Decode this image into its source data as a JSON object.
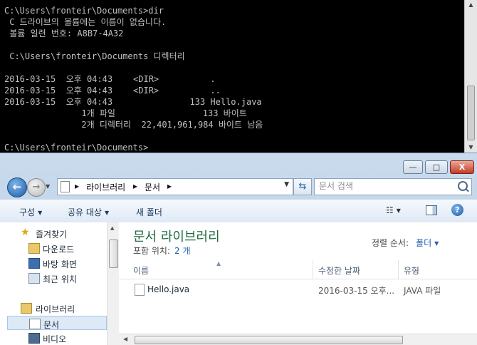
{
  "console": {
    "lines": [
      "C:\\Users\\fronteir\\Documents>dir",
      " C 드라이브의 볼륨에는 이름이 없습니다.",
      " 볼륨 일련 번호: A8B7-4A32",
      "",
      " C:\\Users\\fronteir\\Documents 디렉터리",
      "",
      "2016-03-15  오후 04:43    <DIR>          .",
      "2016-03-15  오후 04:43    <DIR>          ..",
      "2016-03-15  오후 04:43               133 Hello.java",
      "               1개 파일                 133 바이트",
      "               2개 디렉터리  22,401,961,984 바이트 남음",
      "",
      "C:\\Users\\fronteir\\Documents>"
    ]
  },
  "explorer": {
    "window_buttons": {
      "minimize": "—",
      "maximize": "□",
      "close": "X"
    },
    "breadcrumb": {
      "sep1": "▸",
      "item1": "라이브러리",
      "sep2": "▸",
      "item2": "문서",
      "sep3": "▸"
    },
    "search": {
      "placeholder": "문서 검색"
    },
    "toolbar": {
      "organize": "구성",
      "share_with": "공유 대상",
      "new_folder": "새 폴더"
    },
    "nav": {
      "favorites": "즐겨찾기",
      "downloads": "다운로드",
      "desktop": "바탕 화면",
      "recent_places": "최근 위치",
      "libraries": "라이브러리",
      "documents": "문서",
      "videos": "비디오"
    },
    "content": {
      "title": "문서 라이브러리",
      "includes_label": "포함 위치:",
      "includes_value": "2 개",
      "arrange_label": "정렬 순서:",
      "arrange_value": "폴더",
      "columns": {
        "name": "이름",
        "date_modified": "수정한 날짜",
        "type": "유형"
      },
      "files": [
        {
          "name": "Hello.java",
          "date_modified": "2016-03-15 오후...",
          "type": "JAVA 파일"
        }
      ]
    },
    "colors": {
      "title_green": "#1f6b3f",
      "link_blue": "#1f5fae"
    }
  }
}
